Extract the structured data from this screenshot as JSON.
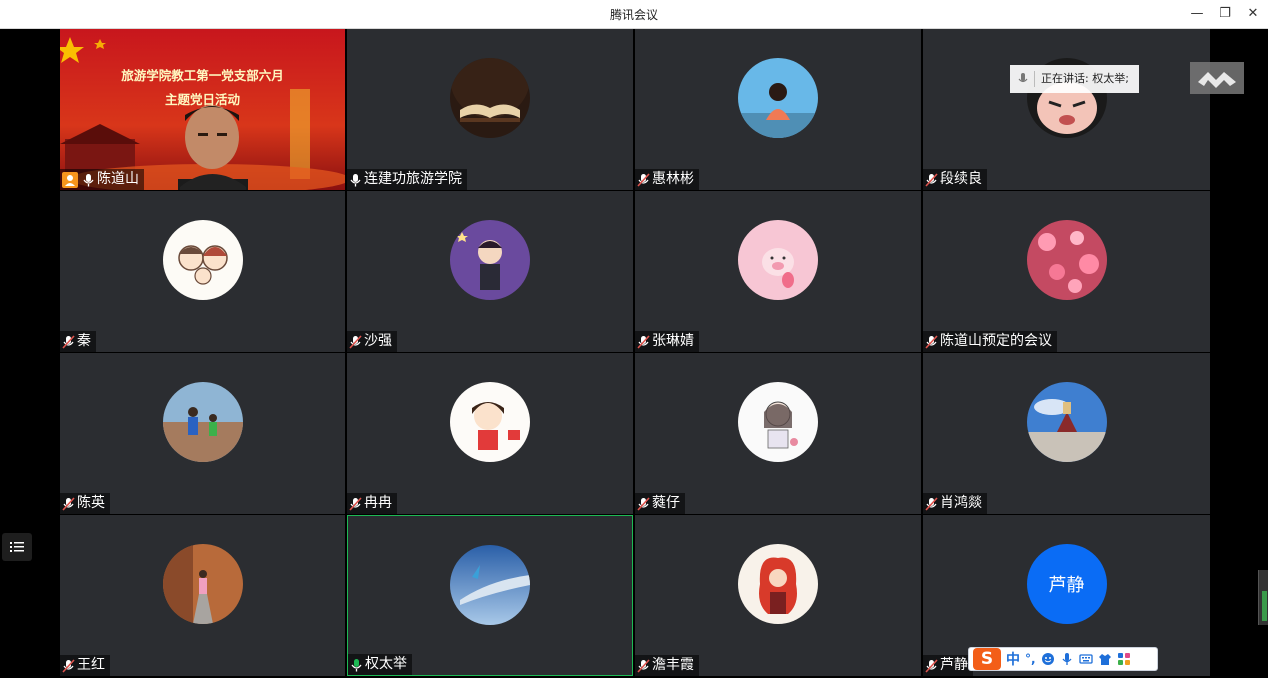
{
  "window": {
    "title": "腾讯会议",
    "minimize_label": "—",
    "restore_label": "❐",
    "close_label": "✕"
  },
  "speaking": {
    "text": "正在讲话: 权太举;"
  },
  "banner": {
    "line1": "旅游学院教工第一党支部六月",
    "line2": "主题党日活动"
  },
  "ime": {
    "logo": "S",
    "mode": "中",
    "punct": "°,"
  },
  "participants": [
    {
      "name": "陈道山",
      "mic": "on",
      "host": true,
      "video": true
    },
    {
      "name": "连建功旅游学院",
      "mic": "on",
      "avatar": "book-avatar"
    },
    {
      "name": "惠林彬",
      "mic": "muted",
      "avatar": "girl-sky-avatar"
    },
    {
      "name": "段续良",
      "mic": "muted",
      "avatar": "cartoon-face-avatar"
    },
    {
      "name": "秦",
      "mic": "muted",
      "avatar": "couple-cartoon-avatar"
    },
    {
      "name": "沙强",
      "mic": "muted",
      "avatar": "purple-cartoon-avatar"
    },
    {
      "name": "张琳婧",
      "mic": "muted",
      "avatar": "pink-pig-avatar"
    },
    {
      "name": "陈道山预定的会议",
      "mic": "muted",
      "avatar": "pink-flowers-avatar"
    },
    {
      "name": "陈英",
      "mic": "muted",
      "avatar": "kids-beach-avatar"
    },
    {
      "name": "冉冉",
      "mic": "muted",
      "avatar": "red-girl-cartoon-avatar"
    },
    {
      "name": "蕤仔",
      "mic": "muted",
      "avatar": "sketch-girl-avatar"
    },
    {
      "name": "肖鸿燚",
      "mic": "muted",
      "avatar": "temple-sky-avatar"
    },
    {
      "name": "王红",
      "mic": "muted",
      "avatar": "autumn-path-avatar"
    },
    {
      "name": "权太举",
      "mic": "active",
      "avatar": "airplane-wing-avatar",
      "speaking": true
    },
    {
      "name": "澹丰霞",
      "mic": "muted",
      "avatar": "red-hair-girl-avatar"
    },
    {
      "name": "芦静",
      "mic": "muted",
      "avatar_text": "芦静"
    }
  ],
  "colors": {
    "tile_bg": "#2b2d31",
    "active_border": "#1db954",
    "text_avatar_bg": "#0a6cf5",
    "mic_muted": "#e0544e",
    "mic_on": "#ffffff",
    "mic_active": "#1db954"
  }
}
